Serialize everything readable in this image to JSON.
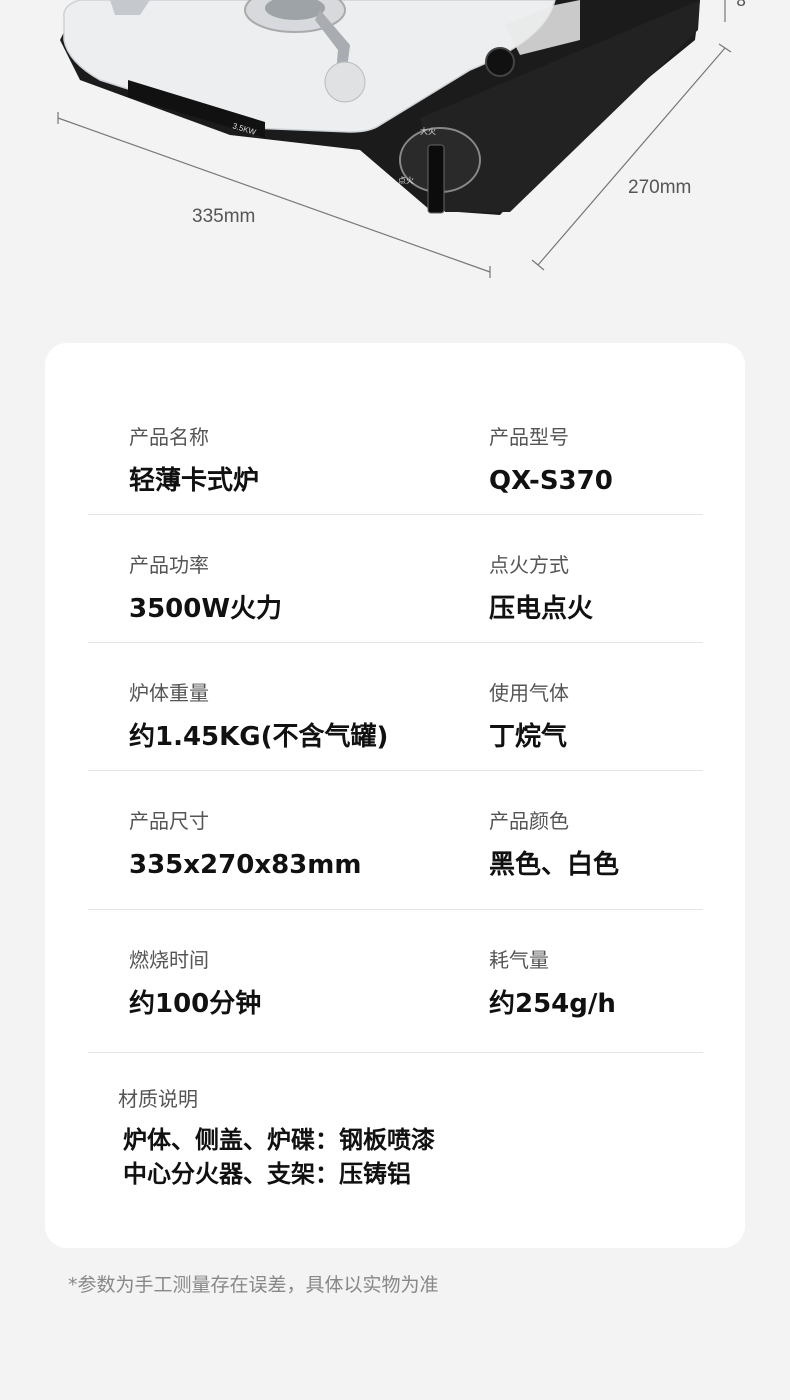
{
  "product_image": {
    "panel_text": [
      "3.5KW"
    ],
    "knob_labels": [
      "大火",
      "点火"
    ]
  },
  "dimensions": {
    "width_label": "335mm",
    "depth_label": "270mm",
    "height_label_partial": "8"
  },
  "specs": [
    {
      "label": "产品名称",
      "value": "轻薄卡式炉"
    },
    {
      "label": "产品型号",
      "value": "QX-S370"
    },
    {
      "label": "产品功率",
      "value": "3500W火力"
    },
    {
      "label": "点火方式",
      "value": "压电点火"
    },
    {
      "label": "炉体重量",
      "value": "约1.45KG(不含气罐)"
    },
    {
      "label": "使用气体",
      "value": "丁烷气"
    },
    {
      "label": "产品尺寸",
      "value": "335x270x83mm"
    },
    {
      "label": "产品颜色",
      "value": "黑色、白色"
    },
    {
      "label": "燃烧时间",
      "value": "约100分钟"
    },
    {
      "label": "耗气量",
      "value": "约254g/h"
    }
  ],
  "material": {
    "label": "材质说明",
    "lines": [
      "炉体、侧盖、炉碟：钢板喷漆",
      "中心分火器、支架：压铸铝"
    ]
  },
  "footnote": "*参数为手工测量存在误差，具体以实物为准",
  "colors": {
    "background": "#f3f3f3",
    "card": "#ffffff",
    "stove_body": "#1b1b1b",
    "stove_top": "#eceef0"
  }
}
